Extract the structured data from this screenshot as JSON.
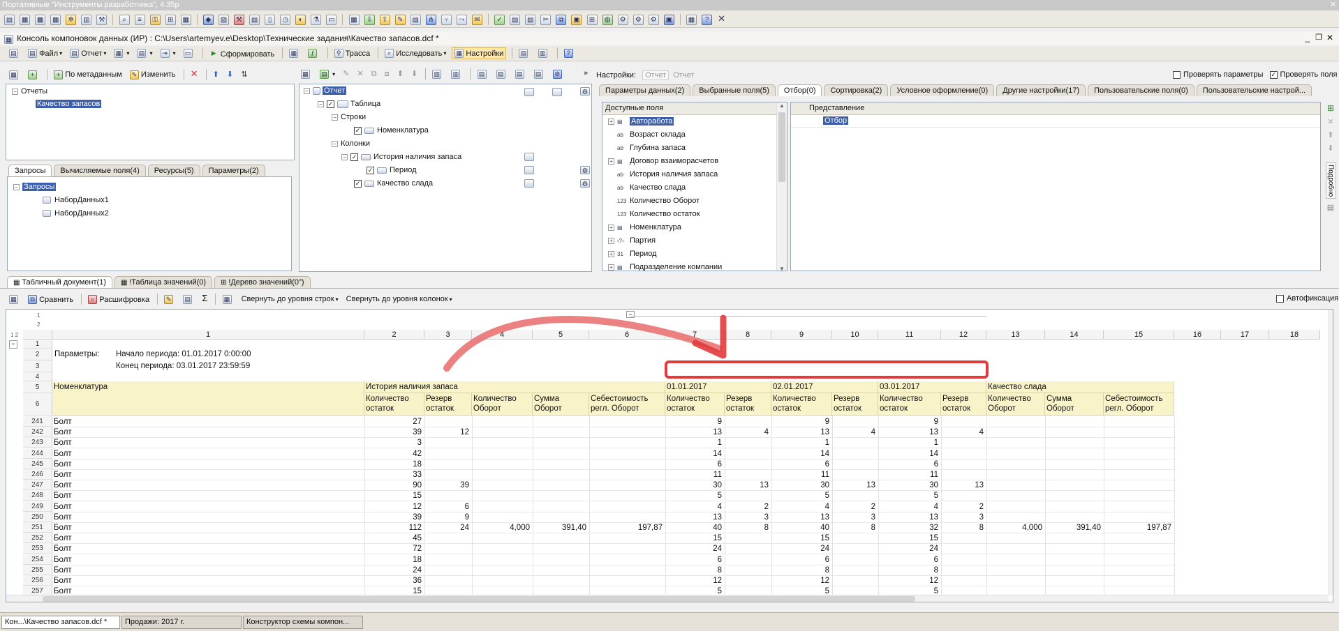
{
  "app": {
    "title": "Портативные \"Инструменты разработчика\", 4.35р",
    "window_title": "Консоль компоновок данных (ИР) : C:\\Users\\artemyev.e\\Desktop\\Технические задания\\Качество запасов.dcf *"
  },
  "toolbar": {
    "file": "Файл",
    "report": "Отчет",
    "form": "Сформировать",
    "trace": "Трасса",
    "explore": "Исследовать",
    "settings": "Настройки"
  },
  "left_toolbar": {
    "by_metadata": "По метаданным",
    "edit": "Изменить"
  },
  "reports_tree": {
    "root": "Отчеты",
    "item": "Качество запасов"
  },
  "left_tabs": [
    "Запросы",
    "Вычисляемые поля(4)",
    "Ресурсы(5)",
    "Параметры(2)"
  ],
  "queries_tree": {
    "root": "Запросы",
    "items": [
      "НаборДанных1",
      "НаборДанных2"
    ]
  },
  "structure_tree": {
    "report": "Отчет",
    "table": "Таблица",
    "rows": "Строки",
    "nomenclature": "Номенклатура",
    "columns": "Колонки",
    "history": "История наличия запаса",
    "period": "Период",
    "quality": "Качество слада"
  },
  "settings_bar": {
    "label": "Настройки:",
    "report1": "Отчет",
    "report2": "Отчет",
    "check_params": "Проверять параметры",
    "check_fields": "Проверять поля"
  },
  "settings_tabs": [
    "Параметры данных(2)",
    "Выбранные поля(5)",
    "Отбор(0)",
    "Сортировка(2)",
    "Условное оформление(0)",
    "Другие настройки(17)",
    "Пользовательские поля(0)",
    "Пользовательские настрой..."
  ],
  "available_fields": {
    "header": "Доступные поля",
    "items": [
      "Авторабота",
      "Возраст склада",
      "Глубина запаса",
      "Договор взаиморасчетов",
      "История наличия запаса",
      "Качество слада",
      "Количество Оборот",
      "Количество остаток",
      "Номенклатура",
      "Партия",
      "Период",
      "Подразделение компании"
    ]
  },
  "filter_panel": {
    "header": "Представление",
    "item": "Отбор",
    "side_label": "Подробно"
  },
  "result_tabs": [
    "Табличный документ(1)",
    "!Таблица значений(0)",
    "!Дерево значений(0\")"
  ],
  "sheet_toolbar": {
    "compare": "Сравнить",
    "decode": "Расшифровка",
    "collapse_rows": "Свернуть до уровня строк",
    "collapse_cols": "Свернуть до уровня колонок",
    "autofix": "Автофиксация"
  },
  "sheet": {
    "col_numbers": [
      "1",
      "2",
      "3",
      "4",
      "5",
      "6",
      "7",
      "8",
      "9",
      "10",
      "11",
      "12",
      "13",
      "14",
      "15",
      "16",
      "17",
      "18"
    ],
    "params_label": "Параметры:",
    "period_start": "Начало периода: 01.01.2017 0:00:00",
    "period_end": "Конец периода: 03.01.2017 23:59:59",
    "hdr_nomenclature": "Номенклатура",
    "hdr_history": "История наличия запаса",
    "hdr_d1": "01.01.2017",
    "hdr_d2": "02.01.2017",
    "hdr_d3": "03.01.2017",
    "hdr_quality": "Качество слада",
    "sub": [
      "Количество остаток",
      "Резерв остаток",
      "Количество Оборот",
      "Сумма Оборот",
      "Себестоимость регл. Оборот",
      "Количество остаток",
      "Резерв остаток",
      "Количество остаток",
      "Резерв остаток",
      "Количество остаток",
      "Резерв остаток",
      "Количество Оборот",
      "Сумма Оборот",
      "Себестоимость регл. Оборот"
    ],
    "header_rows": [
      "1",
      "2",
      "3",
      "4",
      "5",
      "6"
    ],
    "rows": [
      {
        "n": "241",
        "name": "Болт",
        "v": [
          "27",
          "",
          "",
          "",
          "",
          "9",
          "",
          "9",
          "",
          "9",
          "",
          "",
          "",
          ""
        ]
      },
      {
        "n": "242",
        "name": "Болт",
        "v": [
          "39",
          "12",
          "",
          "",
          "",
          "13",
          "4",
          "13",
          "4",
          "13",
          "4",
          "",
          "",
          ""
        ]
      },
      {
        "n": "243",
        "name": "Болт",
        "v": [
          "3",
          "",
          "",
          "",
          "",
          "1",
          "",
          "1",
          "",
          "1",
          "",
          "",
          "",
          ""
        ]
      },
      {
        "n": "244",
        "name": "Болт",
        "v": [
          "42",
          "",
          "",
          "",
          "",
          "14",
          "",
          "14",
          "",
          "14",
          "",
          "",
          "",
          ""
        ]
      },
      {
        "n": "245",
        "name": "Болт",
        "v": [
          "18",
          "",
          "",
          "",
          "",
          "6",
          "",
          "6",
          "",
          "6",
          "",
          "",
          "",
          ""
        ]
      },
      {
        "n": "246",
        "name": "Болт",
        "v": [
          "33",
          "",
          "",
          "",
          "",
          "11",
          "",
          "11",
          "",
          "11",
          "",
          "",
          "",
          ""
        ]
      },
      {
        "n": "247",
        "name": "Болт",
        "v": [
          "90",
          "39",
          "",
          "",
          "",
          "30",
          "13",
          "30",
          "13",
          "30",
          "13",
          "",
          "",
          ""
        ]
      },
      {
        "n": "248",
        "name": "Болт",
        "v": [
          "15",
          "",
          "",
          "",
          "",
          "5",
          "",
          "5",
          "",
          "5",
          "",
          "",
          "",
          ""
        ]
      },
      {
        "n": "249",
        "name": "Болт",
        "v": [
          "12",
          "6",
          "",
          "",
          "",
          "4",
          "2",
          "4",
          "2",
          "4",
          "2",
          "",
          "",
          ""
        ]
      },
      {
        "n": "250",
        "name": "Болт",
        "v": [
          "39",
          "9",
          "",
          "",
          "",
          "13",
          "3",
          "13",
          "3",
          "13",
          "3",
          "",
          "",
          ""
        ]
      },
      {
        "n": "251",
        "name": "Болт",
        "v": [
          "112",
          "24",
          "4,000",
          "391,40",
          "197,87",
          "40",
          "8",
          "40",
          "8",
          "32",
          "8",
          "4,000",
          "391,40",
          "197,87"
        ]
      },
      {
        "n": "252",
        "name": "Болт",
        "v": [
          "45",
          "",
          "",
          "",
          "",
          "15",
          "",
          "15",
          "",
          "15",
          "",
          "",
          "",
          ""
        ]
      },
      {
        "n": "253",
        "name": "Болт",
        "v": [
          "72",
          "",
          "",
          "",
          "",
          "24",
          "",
          "24",
          "",
          "24",
          "",
          "",
          "",
          ""
        ]
      },
      {
        "n": "254",
        "name": "Болт",
        "v": [
          "18",
          "",
          "",
          "",
          "",
          "6",
          "",
          "6",
          "",
          "6",
          "",
          "",
          "",
          ""
        ]
      },
      {
        "n": "255",
        "name": "Болт",
        "v": [
          "24",
          "",
          "",
          "",
          "",
          "8",
          "",
          "8",
          "",
          "8",
          "",
          "",
          "",
          ""
        ]
      },
      {
        "n": "256",
        "name": "Болт",
        "v": [
          "36",
          "",
          "",
          "",
          "",
          "12",
          "",
          "12",
          "",
          "12",
          "",
          "",
          "",
          ""
        ]
      },
      {
        "n": "257",
        "name": "Болт",
        "v": [
          "15",
          "",
          "",
          "",
          "",
          "5",
          "",
          "5",
          "",
          "5",
          "",
          "",
          "",
          ""
        ]
      }
    ]
  },
  "taskbar": [
    "Кон...\\Качество запасов.dcf *",
    "Продажи: 2017 г.",
    "Конструктор схемы компон..."
  ],
  "colors": {
    "accent": "#3d5fab",
    "annotation": "#e23b3b",
    "header_fill": "#f8f3c8"
  }
}
